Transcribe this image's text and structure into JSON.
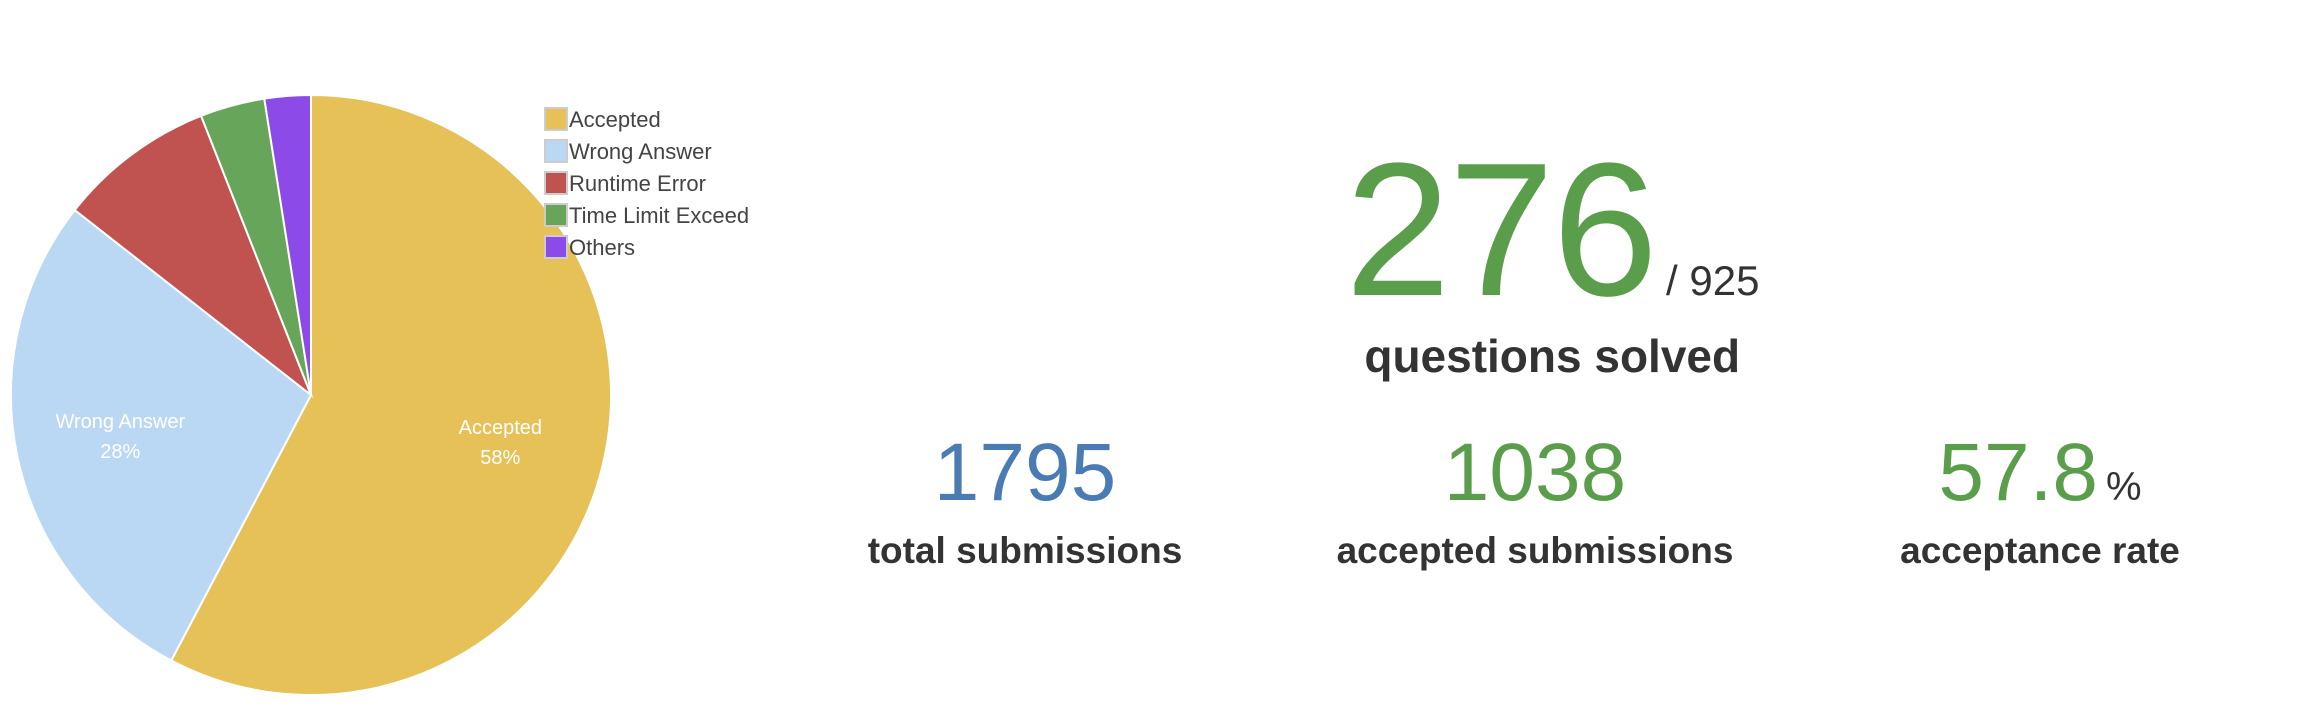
{
  "chart_data": {
    "type": "pie",
    "slices": [
      {
        "label": "Accepted",
        "value": 58,
        "color": "#e5c158",
        "text": "58%"
      },
      {
        "label": "Wrong Answer",
        "value": 28,
        "color": "#bad8f3",
        "text": "28%"
      },
      {
        "label": "Runtime Error",
        "value": 8.5,
        "color": "#c0524f",
        "text": ""
      },
      {
        "label": "Time Limit Exceed",
        "value": 3.5,
        "color": "#67a55a",
        "text": ""
      },
      {
        "label": "Others",
        "value": 2.5,
        "color": "#8c4be9",
        "text": ""
      }
    ],
    "legend_position": "top-right"
  },
  "stats": {
    "solved": "276",
    "total_questions": "/ 925",
    "solved_label": "questions solved",
    "submissions": "1795",
    "submissions_label": "total submissions",
    "accepted": "1038",
    "accepted_label": "accepted submissions",
    "rate": "57.8",
    "rate_unit": "%",
    "rate_label": "acceptance rate"
  },
  "colors": {
    "green": "#5a9e4b",
    "blue": "#4a7cb3"
  }
}
